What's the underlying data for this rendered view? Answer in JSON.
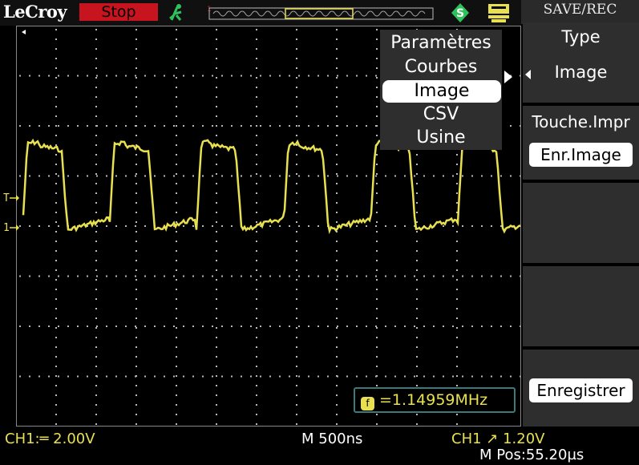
{
  "header": {
    "brand": "LeCroy",
    "run_state": "Stop",
    "colors": {
      "run_state_bg": "#c8141e",
      "ch1": "#e8e050",
      "accent_green": "#2ec25a"
    }
  },
  "side_menu": {
    "title": "SAVE/REC",
    "type_label": "Type",
    "type_value": "Image",
    "print_key_label": "Touche.Impr",
    "print_key_value": "Enr.Image",
    "save_label": "Enregistrer"
  },
  "type_popup": {
    "options": [
      "Paramètres",
      "Courbes",
      "Image",
      "CSV",
      "Usine"
    ],
    "selected": "Image"
  },
  "markers": {
    "ch1": "1",
    "trigger": "T"
  },
  "readout": {
    "frequency": "=1.14959MHz"
  },
  "status": {
    "ch1": "CH1:═ 2.00V",
    "timebase": "M 500ns",
    "trigger": "CH1 ↗ 1.20V",
    "m_pos": "M Pos:55.20µs"
  },
  "waveform": {
    "channel": "CH1",
    "shape": "square",
    "period_divisions": 2.17,
    "high_level_divisions": 3.35,
    "low_level_divisions": 0.95
  }
}
